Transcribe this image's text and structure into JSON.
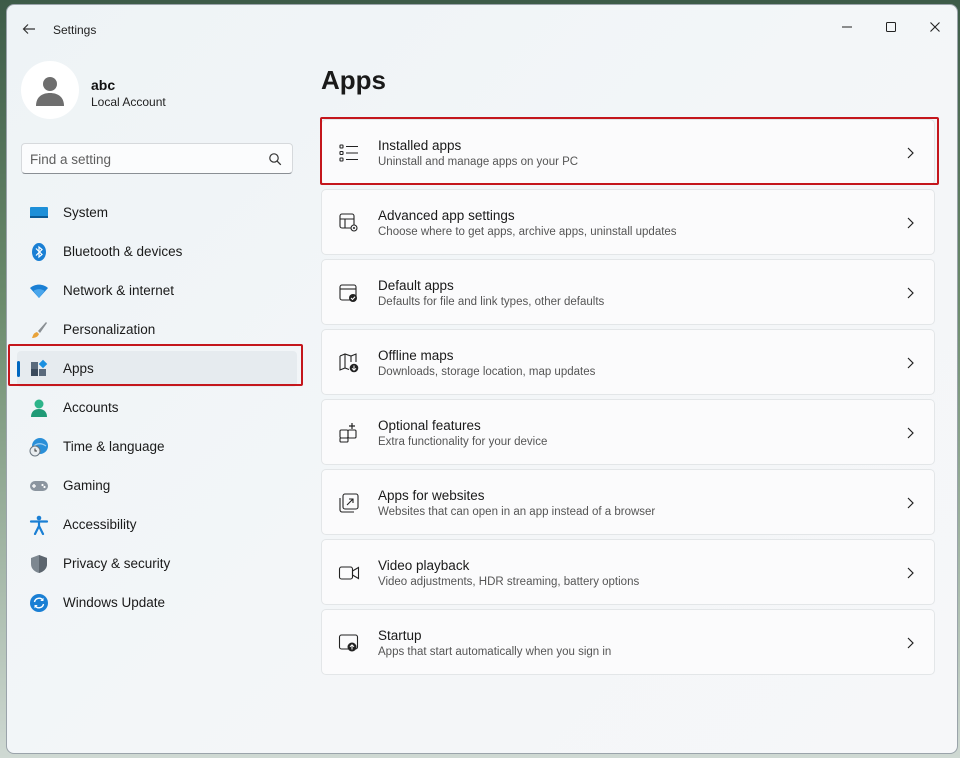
{
  "window": {
    "title": "Settings"
  },
  "profile": {
    "name": "abc",
    "account_type": "Local Account"
  },
  "search": {
    "placeholder": "Find a setting"
  },
  "sidebar": {
    "items": [
      {
        "label": "System",
        "icon": "system-icon"
      },
      {
        "label": "Bluetooth & devices",
        "icon": "bluetooth-icon"
      },
      {
        "label": "Network & internet",
        "icon": "wifi-icon"
      },
      {
        "label": "Personalization",
        "icon": "brush-icon"
      },
      {
        "label": "Apps",
        "icon": "apps-icon",
        "selected": true
      },
      {
        "label": "Accounts",
        "icon": "accounts-icon"
      },
      {
        "label": "Time & language",
        "icon": "globe-clock-icon"
      },
      {
        "label": "Gaming",
        "icon": "gamepad-icon"
      },
      {
        "label": "Accessibility",
        "icon": "accessibility-icon"
      },
      {
        "label": "Privacy & security",
        "icon": "shield-icon"
      },
      {
        "label": "Windows Update",
        "icon": "update-icon"
      }
    ]
  },
  "main": {
    "title": "Apps",
    "cards": [
      {
        "title": "Installed apps",
        "subtitle": "Uninstall and manage apps on your PC",
        "icon": "list-icon"
      },
      {
        "title": "Advanced app settings",
        "subtitle": "Choose where to get apps, archive apps, uninstall updates",
        "icon": "app-gear-icon"
      },
      {
        "title": "Default apps",
        "subtitle": "Defaults for file and link types, other defaults",
        "icon": "default-apps-icon"
      },
      {
        "title": "Offline maps",
        "subtitle": "Downloads, storage location, map updates",
        "icon": "map-download-icon"
      },
      {
        "title": "Optional features",
        "subtitle": "Extra functionality for your device",
        "icon": "add-feature-icon"
      },
      {
        "title": "Apps for websites",
        "subtitle": "Websites that can open in an app instead of a browser",
        "icon": "open-in-app-icon"
      },
      {
        "title": "Video playback",
        "subtitle": "Video adjustments, HDR streaming, battery options",
        "icon": "video-icon"
      },
      {
        "title": "Startup",
        "subtitle": "Apps that start automatically when you sign in",
        "icon": "startup-icon"
      }
    ]
  },
  "colors": {
    "accent": "#0067c0",
    "highlight": "#c4161c"
  }
}
